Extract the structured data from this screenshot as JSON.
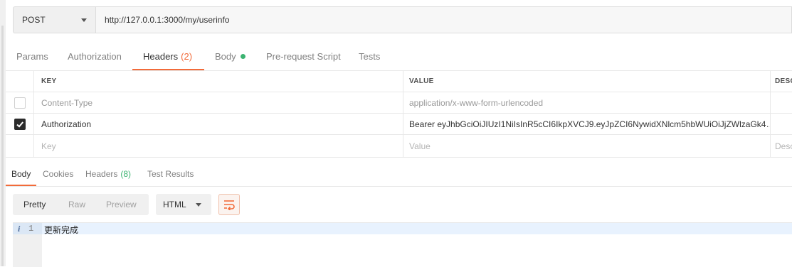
{
  "request": {
    "method": "POST",
    "url": "http://127.0.0.1:3000/my/userinfo"
  },
  "request_tabs": [
    {
      "label": "Params"
    },
    {
      "label": "Authorization"
    },
    {
      "label": "Headers",
      "count": "(2)",
      "active": true
    },
    {
      "label": "Body",
      "indicator": "green-dot"
    },
    {
      "label": "Pre-request Script"
    },
    {
      "label": "Tests"
    }
  ],
  "headers_table": {
    "columns": {
      "key": "KEY",
      "value": "VALUE",
      "description": "DESCRIPTION"
    },
    "rows": [
      {
        "checked": false,
        "key": "Content-Type",
        "value": "application/x-www-form-urlencoded"
      },
      {
        "checked": true,
        "key": "Authorization",
        "value": "Bearer eyJhbGciOiJIUzI1NiIsInR5cCI6IkpXVCJ9.eyJpZCI6NywidXNlcm5hbWUiOiJjZWlzaGk4…"
      }
    ],
    "new_row": {
      "key_placeholder": "Key",
      "value_placeholder": "Value",
      "description_placeholder": "Description"
    }
  },
  "response_tabs": [
    {
      "label": "Body",
      "active": true
    },
    {
      "label": "Cookies"
    },
    {
      "label": "Headers",
      "count": "(8)"
    },
    {
      "label": "Test Results"
    }
  ],
  "response_toolbar": {
    "modes": [
      "Pretty",
      "Raw",
      "Preview"
    ],
    "active_mode": "Pretty",
    "format": "HTML",
    "wrap_icon": "wrap-lines-icon"
  },
  "editor": {
    "line_number": "1",
    "gutter_marker": "i",
    "line_text": "更新完成"
  },
  "colors": {
    "accent": "#f26b3a",
    "success": "#3cb371"
  }
}
